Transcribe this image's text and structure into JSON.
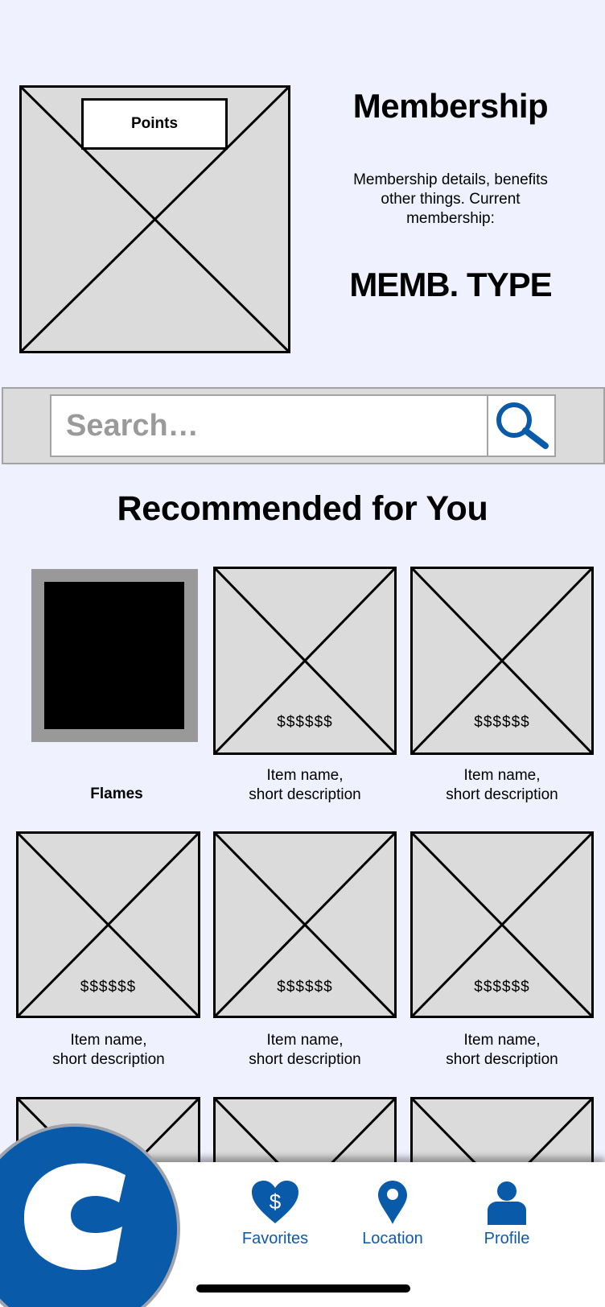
{
  "membership": {
    "points_label": "Points",
    "title": "Membership",
    "description": "Membership details, benefits other things. Current membership:",
    "type": "MEMB. TYPE"
  },
  "search": {
    "placeholder": "Search…",
    "icon": "search-icon"
  },
  "recommended": {
    "title": "Recommended for You",
    "featured_label": "Flames",
    "items": [
      {
        "price": "$$$$$$",
        "label": "Item name,\nshort description"
      },
      {
        "price": "$$$$$$",
        "label": "Item name,\nshort description"
      },
      {
        "price": "$$$$$$",
        "label": "Item name,\nshort description"
      },
      {
        "price": "$$$$$$",
        "label": "Item name,\nshort description"
      },
      {
        "price": "$$$$$$",
        "label": "Item name,\nshort description"
      }
    ]
  },
  "nav": {
    "favorites": "Favorites",
    "location": "Location",
    "profile": "Profile"
  },
  "colors": {
    "background": "#eff1fe",
    "brand_blue": "#0a5aaa",
    "placeholder_gray": "#dcdbdc"
  }
}
